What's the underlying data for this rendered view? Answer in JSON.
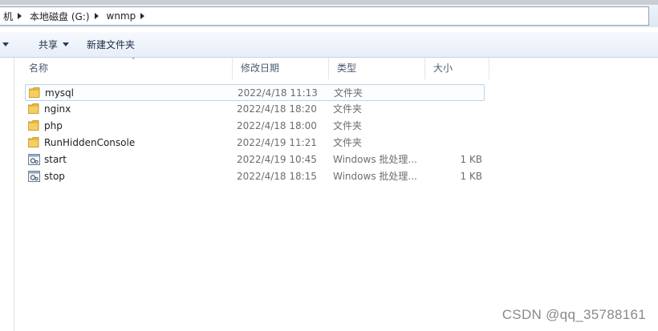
{
  "address": {
    "crumbs": [
      "机",
      "本地磁盘 (G:)",
      "wnmp"
    ]
  },
  "toolbar": {
    "share_label": "共享",
    "new_folder_label": "新建文件夹"
  },
  "columns": {
    "name": "名称",
    "date": "修改日期",
    "type": "类型",
    "size": "大小"
  },
  "files": [
    {
      "icon": "folder-icon",
      "name": "mysql",
      "date": "2022/4/18 11:13",
      "type": "文件夹",
      "size": ""
    },
    {
      "icon": "folder-icon",
      "name": "nginx",
      "date": "2022/4/18 18:20",
      "type": "文件夹",
      "size": ""
    },
    {
      "icon": "folder-icon",
      "name": "php",
      "date": "2022/4/18 18:00",
      "type": "文件夹",
      "size": ""
    },
    {
      "icon": "folder-icon",
      "name": "RunHiddenConsole",
      "date": "2022/4/19 11:21",
      "type": "文件夹",
      "size": ""
    },
    {
      "icon": "batch-file-icon",
      "name": "start",
      "date": "2022/4/19 10:45",
      "type": "Windows 批处理...",
      "size": "1 KB"
    },
    {
      "icon": "batch-file-icon",
      "name": "stop",
      "date": "2022/4/18 18:15",
      "type": "Windows 批处理...",
      "size": "1 KB"
    }
  ],
  "watermark": "CSDN @qq_35788161",
  "colors": {
    "selection_border": "#b9d4ee",
    "folder": "#e8b840",
    "toolbar_bg": "#e6eef8"
  }
}
